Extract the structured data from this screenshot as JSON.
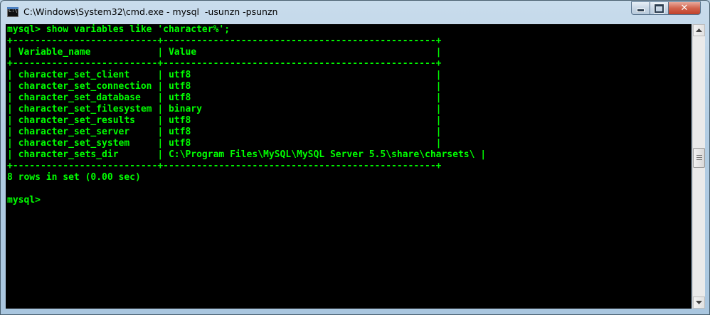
{
  "window": {
    "title": "C:\\Windows\\System32\\cmd.exe - mysql  -usunzn -psunzn",
    "app_icon_text": "C:\\",
    "close_label": "✕"
  },
  "console": {
    "lines": [
      "mysql> show variables like 'character%';",
      "+--------------------------+-------------------------------------------------+",
      "| Variable_name            | Value                                           |",
      "+--------------------------+-------------------------------------------------+",
      "| character_set_client     | utf8                                            |",
      "| character_set_connection | utf8                                            |",
      "| character_set_database   | utf8                                            |",
      "| character_set_filesystem | binary                                          |",
      "| character_set_results    | utf8                                            |",
      "| character_set_server     | utf8                                            |",
      "| character_set_system     | utf8                                            |",
      "| character_sets_dir       | C:\\Program Files\\MySQL\\MySQL Server 5.5\\share\\charsets\\ |",
      "+--------------------------+-------------------------------------------------+",
      "8 rows in set (0.00 sec)",
      "",
      "mysql>"
    ]
  },
  "colors": {
    "console_bg": "#000000",
    "console_text": "#00ff00",
    "close_button": "#c7432c"
  }
}
